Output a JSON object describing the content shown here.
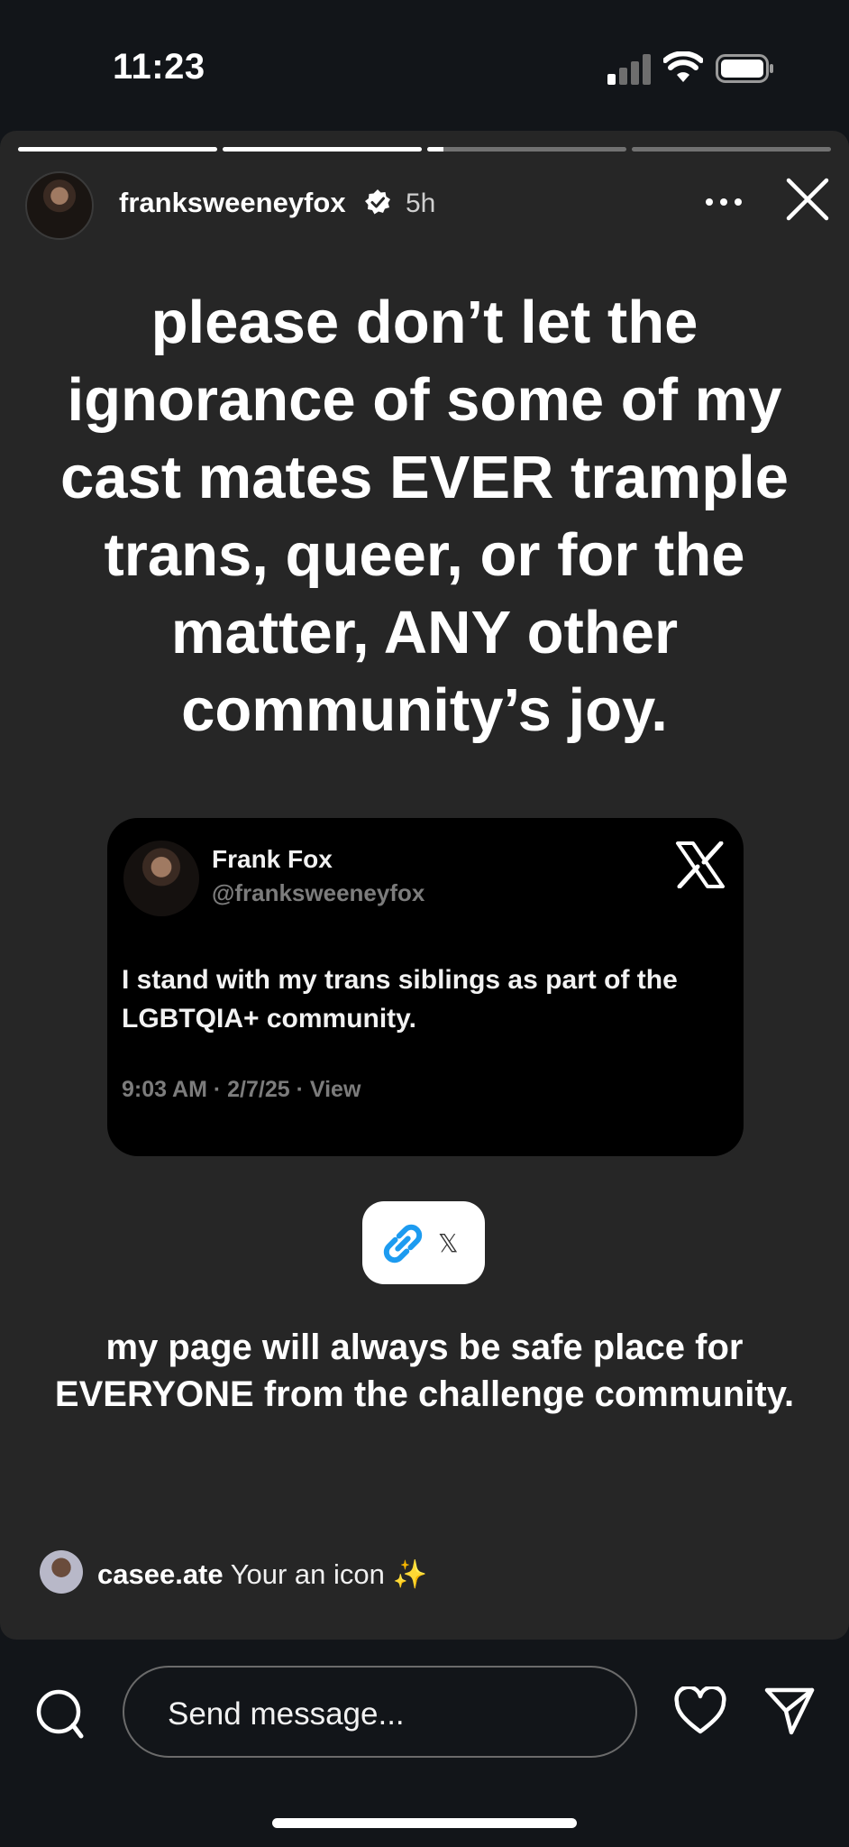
{
  "status_bar": {
    "time": "11:23"
  },
  "story": {
    "progress_segments": [
      1,
      1,
      0.08,
      0
    ],
    "username": "franksweeneyfox",
    "time_ago": "5h",
    "headline": "please don’t let the ignorance of some of my cast mates EVER trample trans, queer, or for the matter, ANY other community’s joy.",
    "tweet": {
      "name": "Frank Fox",
      "handle": "@franksweeneyfox",
      "body": "I stand with my trans siblings as part of the LGBTQIA+ community.",
      "meta": "9:03 AM · 2/7/25 · View"
    },
    "link_sticker": {
      "label": "𝕏"
    },
    "caption": "my page will always be safe place for EVERYONE from the challenge community."
  },
  "comment": {
    "user": "casee.ate",
    "text": "Your an icon ✨"
  },
  "bottom_bar": {
    "message_placeholder": "Send message..."
  },
  "colors": {
    "background": "#121519",
    "story_card": "#262626",
    "tweet_card": "#000000",
    "link_blue": "#1d9bf0",
    "verified_badge": "#ffffff"
  },
  "icons": [
    "signal-icon",
    "wifi-icon",
    "battery-icon",
    "verified-icon",
    "more-icon",
    "close-icon",
    "x-logo-icon",
    "link-icon",
    "search-icon",
    "heart-icon",
    "send-icon"
  ]
}
